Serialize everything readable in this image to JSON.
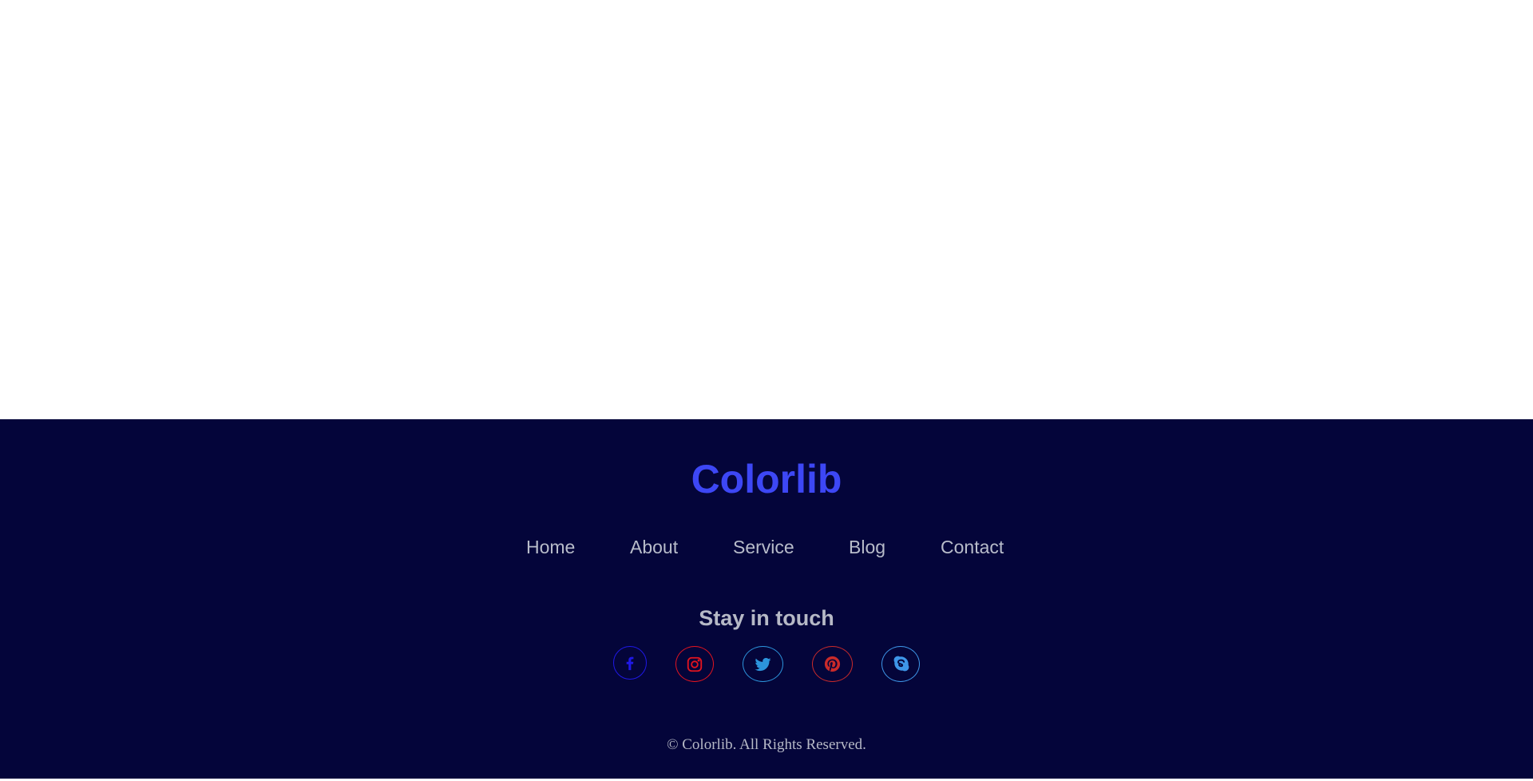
{
  "footer": {
    "brand": "Colorlib",
    "nav": {
      "home": "Home",
      "about": "About",
      "service": "Service",
      "blog": "Blog",
      "contact": "Contact"
    },
    "social_heading": "Stay in touch",
    "social": [
      {
        "name": "facebook-icon",
        "color": "#1f18e6"
      },
      {
        "name": "instagram-icon",
        "color": "#e3141f"
      },
      {
        "name": "twitter-icon",
        "color": "#2c94dc"
      },
      {
        "name": "pinterest-icon",
        "color": "#c92a2a"
      },
      {
        "name": "skype-icon",
        "color": "#3e96e8"
      }
    ],
    "copyright": "© Colorlib. All Rights Reserved.",
    "background_color": "#04053a",
    "brand_color": "#3d47f5",
    "text_color": "#b8bcca"
  }
}
